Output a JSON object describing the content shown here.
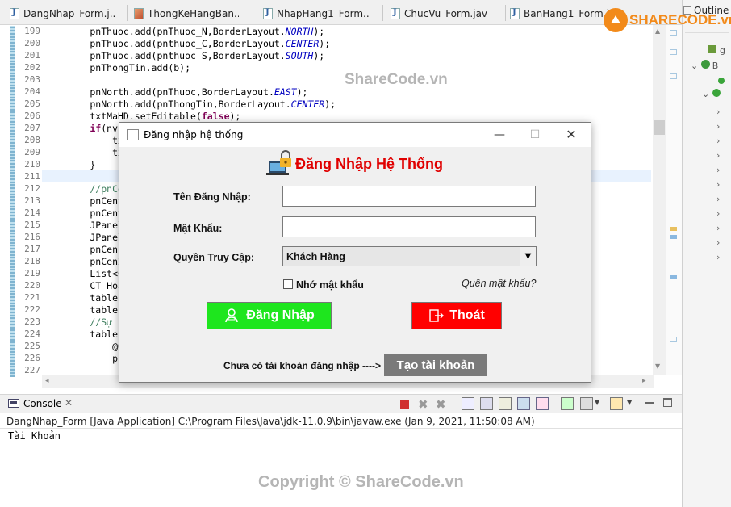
{
  "editor_tabs": [
    {
      "label": "DangNhap_Form.j..."
    },
    {
      "label": "ThongKeHangBan...."
    },
    {
      "label": "NhapHang1_Form...."
    },
    {
      "label": "ChucVu_Form.java"
    },
    {
      "label": "BanHang1_Form.j..."
    }
  ],
  "outline": {
    "title": "Outline",
    "items": [
      "g",
      "B"
    ]
  },
  "code": {
    "line_numbers": [
      "199",
      "200",
      "201",
      "202",
      "203",
      "204",
      "205",
      "206",
      "207",
      "208",
      "209",
      "210",
      "211",
      "212",
      "213",
      "214",
      "215",
      "216",
      "217",
      "218",
      "219",
      "220",
      "221",
      "222",
      "223",
      "224",
      "225",
      "226",
      "227"
    ],
    "lines": [
      "        pnThuoc.add(pnThuoc_N,BorderLayout.NORTH);",
      "        pnThuoc.add(pnthuoc_C,BorderLayout.CENTER);",
      "        pnThuoc.add(pnthuoc_S,BorderLayout.SOUTH);",
      "        pnThongTin.add(b);",
      "",
      "        pnNorth.add(pnThuoc,BorderLayout.EAST);",
      "        pnNorth.add(pnThongTin,BorderLayout.CENTER);",
      "        txtMaHD.setEditable(false);",
      "        if(nv",
      "            tx",
      "            tx",
      "        }",
      "",
      "        //pnCe",
      "        pnCent",
      "        pnCent",
      "        JPanel",
      "        JPanel",
      "        pnCen1",
      "        pnCen2",
      "        List<C",
      "        CT_Hoa",
      "        table1",
      "        table1",
      "        //Sự k",
      "        table1",
      "            @O",
      "            pu",
      ""
    ]
  },
  "console": {
    "tab_label": "Console",
    "description": "DangNhap_Form [Java Application] C:\\Program Files\\Java\\jdk-11.0.9\\bin\\javaw.exe  (Jan 9, 2021, 11:50:08 AM)",
    "output": "Tài Khoản"
  },
  "dialog": {
    "title": "Đăng nhập hệ thống",
    "heading": "Đăng Nhập Hệ Thống",
    "username_label": "Tên Đăng Nhập:",
    "username_value": "",
    "password_label": "Mật Khẩu:",
    "password_value": "",
    "role_label": "Quyền Truy Cập:",
    "role_value": "Khách Hàng",
    "remember_label": "Nhớ mật khẩu",
    "remember_checked": false,
    "forgot_link": "Quên mật khẩu?",
    "login_button": "Đăng Nhập",
    "exit_button": "Thoát",
    "no_account_text": "Chưa có tài khoản đăng nhập",
    "arrow_text": "---->",
    "create_account_button": "Tạo tài khoản",
    "colors": {
      "login_bg": "#1ee61e",
      "exit_bg": "#ff0000",
      "create_bg": "#7a7a7a",
      "heading": "#e00000"
    }
  },
  "watermarks": {
    "logo_text": "SHARECODE.vn",
    "top": "ShareCode.vn",
    "bottom": "Copyright © ShareCode.vn"
  }
}
